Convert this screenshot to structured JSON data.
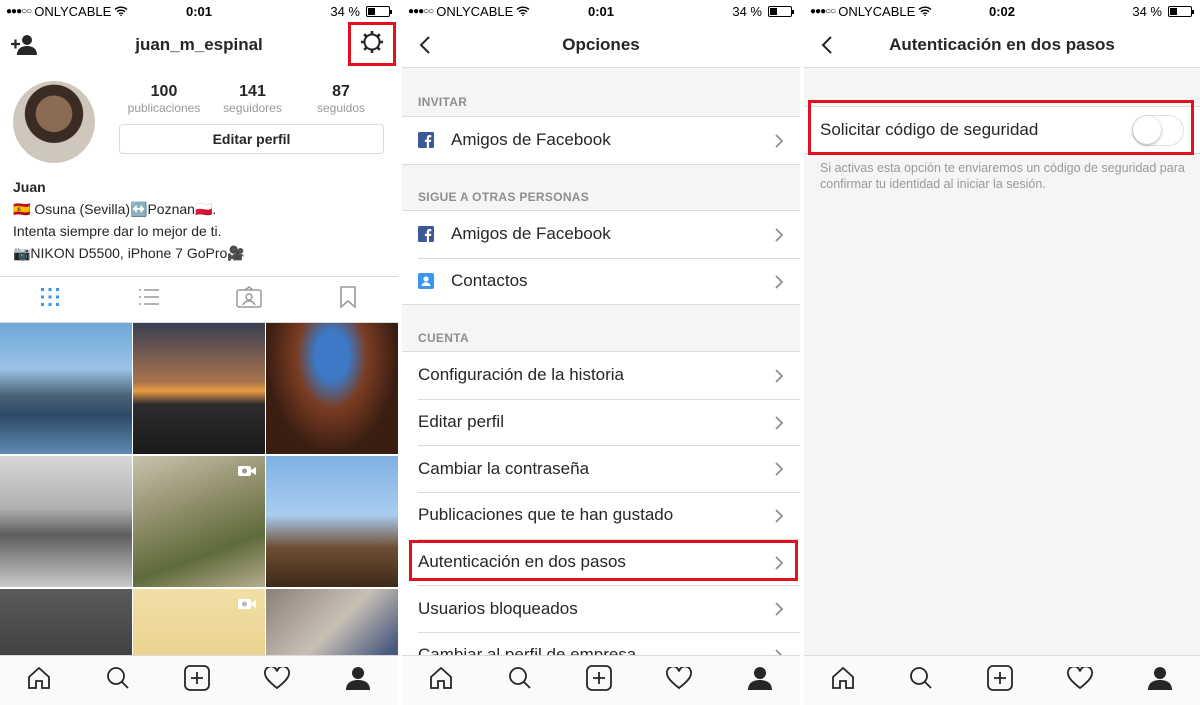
{
  "status_bars": [
    {
      "carrier": "ONLYCABLE",
      "time": "0:01",
      "battery": "34 %",
      "battery_level": 0.34
    },
    {
      "carrier": "ONLYCABLE",
      "time": "0:01",
      "battery": "34 %",
      "battery_level": 0.34
    },
    {
      "carrier": "ONLYCABLE",
      "time": "0:02",
      "battery": "34 %",
      "battery_level": 0.34
    }
  ],
  "profile": {
    "username": "juan_m_espinal",
    "stats": [
      {
        "count": "100",
        "label": "publicaciones"
      },
      {
        "count": "141",
        "label": "seguidores"
      },
      {
        "count": "87",
        "label": "seguidos"
      }
    ],
    "edit_button": "Editar perfil",
    "name": "Juan",
    "bio_lines": [
      "🇪🇸 Osuna (Sevilla)↔️Poznan🇵🇱.",
      "Intenta siempre dar lo mejor de ti.",
      "📷NIKON D5500, iPhone 7 GoPro🎥"
    ],
    "icons": [
      "add-user-icon",
      "gear-icon",
      "grid-icon",
      "list-icon",
      "tagged-icon",
      "bookmark-icon"
    ]
  },
  "options": {
    "title": "Opciones",
    "sections": [
      {
        "header": "INVITAR",
        "items": [
          {
            "label": "Amigos de Facebook",
            "icon": "facebook-icon"
          }
        ]
      },
      {
        "header": "SIGUE A OTRAS PERSONAS",
        "items": [
          {
            "label": "Amigos de Facebook",
            "icon": "facebook-icon"
          },
          {
            "label": "Contactos",
            "icon": "contacts-icon"
          }
        ]
      },
      {
        "header": "CUENTA",
        "items": [
          {
            "label": "Configuración de la historia"
          },
          {
            "label": "Editar perfil"
          },
          {
            "label": "Cambiar la contraseña"
          },
          {
            "label": "Publicaciones que te han gustado"
          },
          {
            "label": "Autenticación en dos pasos"
          },
          {
            "label": "Usuarios bloqueados"
          },
          {
            "label": "Cambiar al perfil de empresa"
          }
        ]
      }
    ]
  },
  "two_factor": {
    "title": "Autenticación en dos pasos",
    "toggle_label": "Solicitar código de seguridad",
    "toggle_on": false,
    "help_text": "Si activas esta opción te enviaremos un código de seguridad para confirmar tu identidad al iniciar la sesión."
  },
  "colors": {
    "highlight": "#e0101f",
    "facebook": "#3b5998",
    "contacts": "#3897f0",
    "active_tab": "#3897f0"
  }
}
